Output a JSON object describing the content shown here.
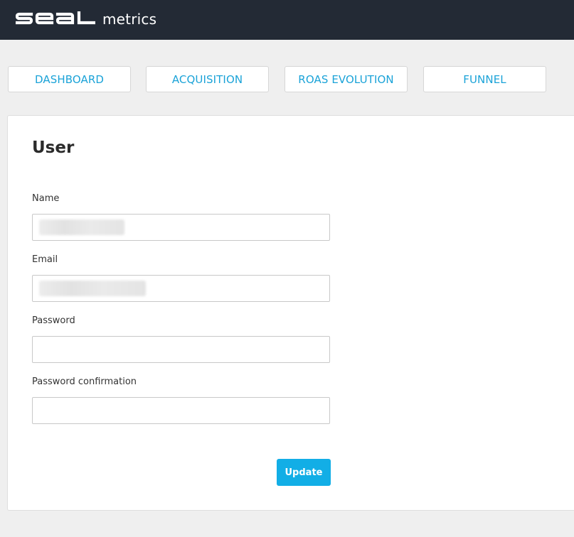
{
  "header": {
    "logo_mark_text": "seal",
    "logo_text": "metrics",
    "background_color": "#232a35"
  },
  "nav": {
    "items": [
      {
        "label": "DASHBOARD"
      },
      {
        "label": "ACQUISITION"
      },
      {
        "label": "ROAS EVOLUTION"
      },
      {
        "label": "FUNNEL"
      }
    ],
    "accent_color": "#1ba3d8"
  },
  "user_form": {
    "title": "User",
    "fields": [
      {
        "label": "Name",
        "value": "",
        "redacted": true
      },
      {
        "label": "Email",
        "value": "",
        "redacted": true
      },
      {
        "label": "Password",
        "value": ""
      },
      {
        "label": "Password confirmation",
        "value": ""
      }
    ],
    "submit_label": "Update",
    "submit_color": "#12aee6"
  }
}
